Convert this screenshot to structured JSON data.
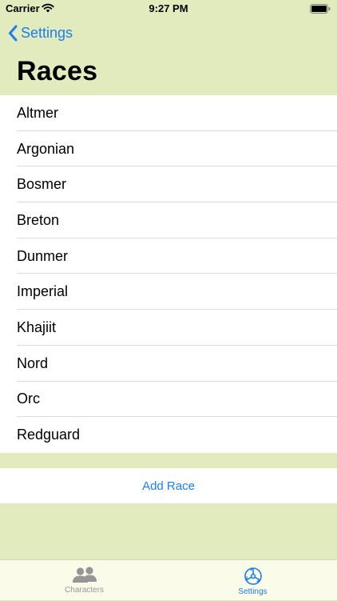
{
  "status_bar": {
    "carrier": "Carrier",
    "time": "9:27 PM",
    "wifi_icon": "wifi-icon",
    "battery_icon": "battery-icon"
  },
  "nav": {
    "back_label": "Settings",
    "back_icon": "chevron-left-icon",
    "title": "Races"
  },
  "races": [
    "Altmer",
    "Argonian",
    "Bosmer",
    "Breton",
    "Dunmer",
    "Imperial",
    "Khajiit",
    "Nord",
    "Orc",
    "Redguard"
  ],
  "actions": {
    "add_label": "Add Race"
  },
  "tab_bar": {
    "tabs": [
      {
        "label": "Characters",
        "icon": "people-icon",
        "selected": false
      },
      {
        "label": "Settings",
        "icon": "settings-wheel-icon",
        "selected": true
      }
    ]
  },
  "colors": {
    "background": "#e1ebbd",
    "accent": "#1a7ff0",
    "tab_bar": "#fbfbe9",
    "inactive_tab": "#969696"
  }
}
